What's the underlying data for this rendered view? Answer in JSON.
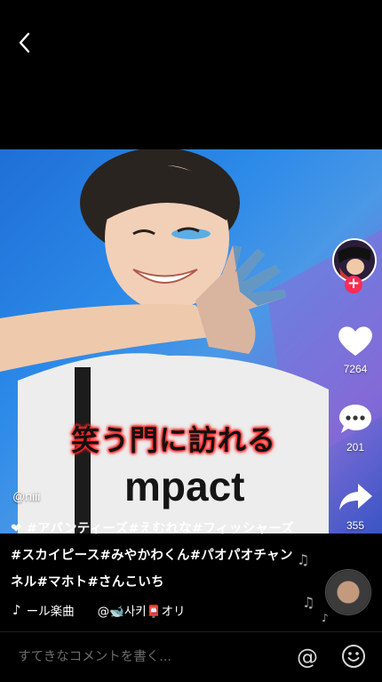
{
  "nav": {
    "back_icon": "chevron-left-icon"
  },
  "video": {
    "overlay_caption": "笑う門に訪れる",
    "shirt_text": "mpact"
  },
  "rail": {
    "like_count": "7264",
    "comment_count": "201",
    "share_count": "355"
  },
  "post": {
    "username": "@niii",
    "description": "❤ #アバンティーズ#えむれな#フィッシャーズ#スカイピース#みやかわくん#パオパオチャンネル#マホト#さんこいち",
    "music_text": "ール楽曲",
    "music_author": "@🐋사키📮オリ"
  },
  "comment": {
    "placeholder": "すてきなコメントを書く..."
  },
  "colors": {
    "accent": "#fe2c55",
    "background": "#000000"
  }
}
